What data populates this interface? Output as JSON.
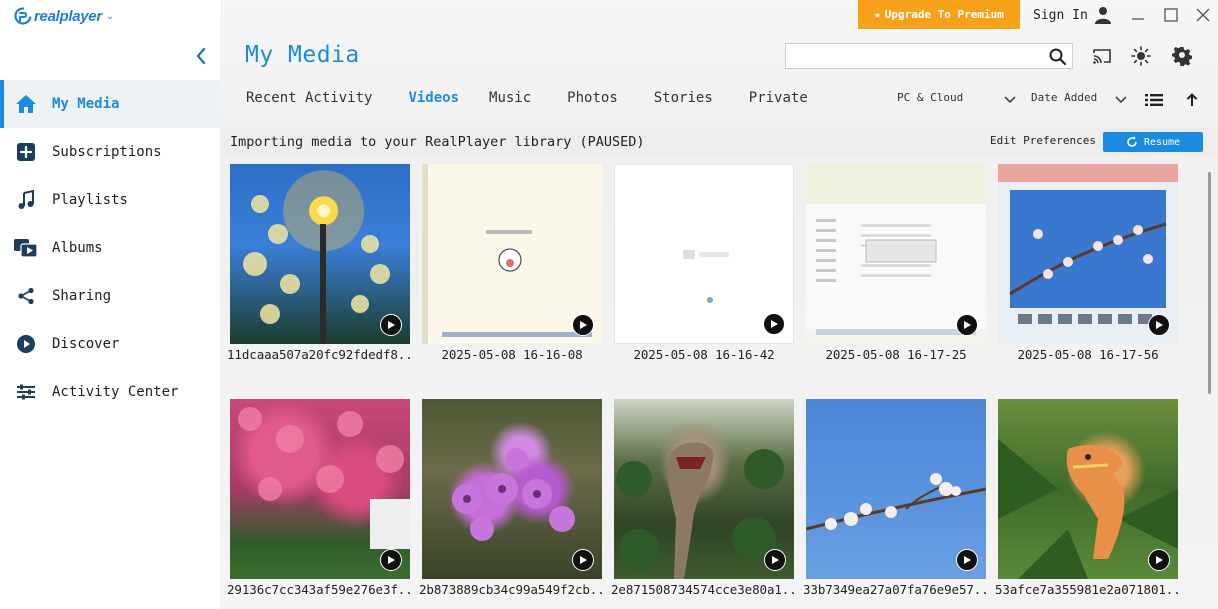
{
  "app": {
    "logo_text": "realplayer",
    "upgrade_label": "Upgrade To Premium",
    "sign_in_label": "Sign In"
  },
  "sidebar": {
    "items": [
      {
        "label": "My Media",
        "icon": "home-icon",
        "active": true
      },
      {
        "label": "Subscriptions",
        "icon": "plus-square-icon",
        "active": false
      },
      {
        "label": "Playlists",
        "icon": "music-note-icon",
        "active": false
      },
      {
        "label": "Albums",
        "icon": "albums-icon",
        "active": false
      },
      {
        "label": "Sharing",
        "icon": "share-icon",
        "active": false
      },
      {
        "label": "Discover",
        "icon": "play-circle-icon",
        "active": false
      },
      {
        "label": "Activity Center",
        "icon": "sliders-icon",
        "active": false
      }
    ]
  },
  "header": {
    "title": "My Media",
    "search": {
      "value": "",
      "placeholder": ""
    }
  },
  "tabs": [
    {
      "label": "Recent Activity",
      "active": false
    },
    {
      "label": "Videos",
      "active": true
    },
    {
      "label": "Music",
      "active": false
    },
    {
      "label": "Photos",
      "active": false
    },
    {
      "label": "Stories",
      "active": false
    },
    {
      "label": "Private",
      "active": false
    }
  ],
  "filters": {
    "source": "PC & Cloud",
    "sort": "Date Added"
  },
  "import": {
    "message": "Importing media to your RealPlayer library (PAUSED)",
    "edit_preferences": "Edit Preferences",
    "resume_label": "Resume"
  },
  "media": [
    {
      "caption": "11dcaaa507a20fc92fdedf8...",
      "thumb": "t-lamp"
    },
    {
      "caption": "2025-05-08 16-16-08",
      "thumb": "t-light"
    },
    {
      "caption": "2025-05-08 16-16-42",
      "thumb": "t-white"
    },
    {
      "caption": "2025-05-08 16-17-25",
      "thumb": "t-screen"
    },
    {
      "caption": "2025-05-08 16-17-56",
      "thumb": "t-blossom-screen"
    },
    {
      "caption": "29136c7cc343af59e276e3f...",
      "thumb": "t-pink"
    },
    {
      "caption": "2b873889cb34c99a549f2cb...",
      "thumb": "t-orchid"
    },
    {
      "caption": "2e871508734574cce3e80a1...",
      "thumb": "t-dino"
    },
    {
      "caption": "33b7349ea27a07fa76e9e57...",
      "thumb": "t-sky"
    },
    {
      "caption": "53afce7a355981e2a071801...",
      "thumb": "t-fern"
    }
  ],
  "colors": {
    "accent": "#1a8be0",
    "upgrade": "#f7a11b"
  }
}
